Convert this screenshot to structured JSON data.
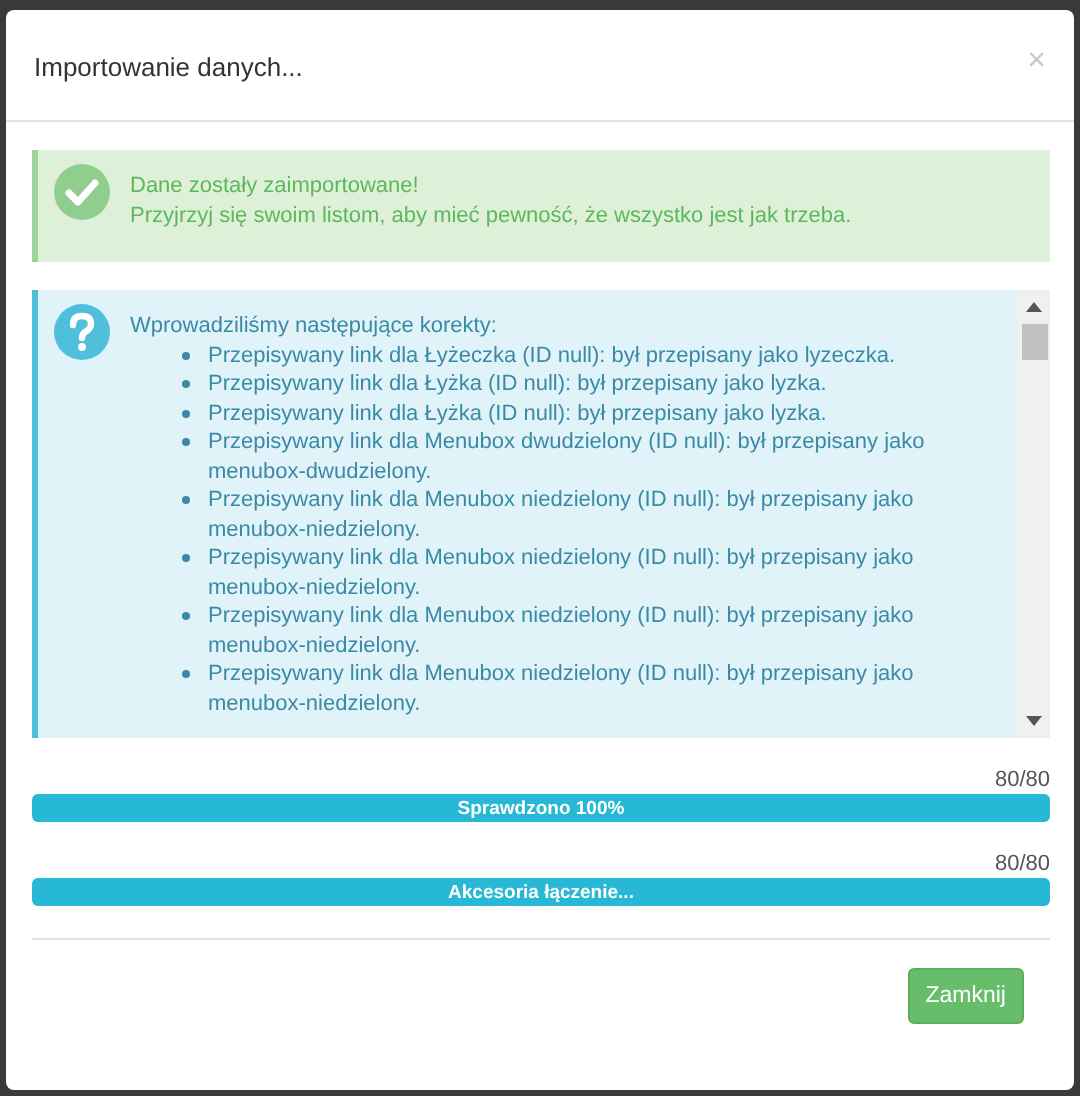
{
  "modal": {
    "title": "Importowanie danych...",
    "close": "×"
  },
  "success_alert": {
    "lines": [
      "Dane zostały zaimportowane!",
      "Przyjrzyj się swoim listom, aby mieć pewność, że wszystko jest jak trzeba."
    ]
  },
  "info_alert": {
    "heading": "Wprowadziliśmy następujące korekty:",
    "items": [
      "Przepisywany link dla Łyżeczka (ID null): był przepisany jako lyzeczka.",
      "Przepisywany link dla Łyżka (ID null): był przepisany jako lyzka.",
      "Przepisywany link dla Łyżka (ID null): był przepisany jako lyzka.",
      "Przepisywany link dla Menubox dwudzielony (ID null): był przepisany jako menubox-dwudzielony.",
      "Przepisywany link dla Menubox niedzielony (ID null): był przepisany jako menubox-niedzielony.",
      "Przepisywany link dla Menubox niedzielony (ID null): był przepisany jako menubox-niedzielony.",
      "Przepisywany link dla Menubox niedzielony (ID null): był przepisany jako menubox-niedzielony.",
      "Przepisywany link dla Menubox niedzielony (ID null): był przepisany jako menubox-niedzielony."
    ]
  },
  "progress": [
    {
      "count": "80/80",
      "label": "Sprawdzono 100%",
      "level": 1
    },
    {
      "count": "80/80",
      "label": "Akcesoria łączenie...",
      "level": 1
    }
  ],
  "buttons": [
    "Zamknij"
  ]
}
